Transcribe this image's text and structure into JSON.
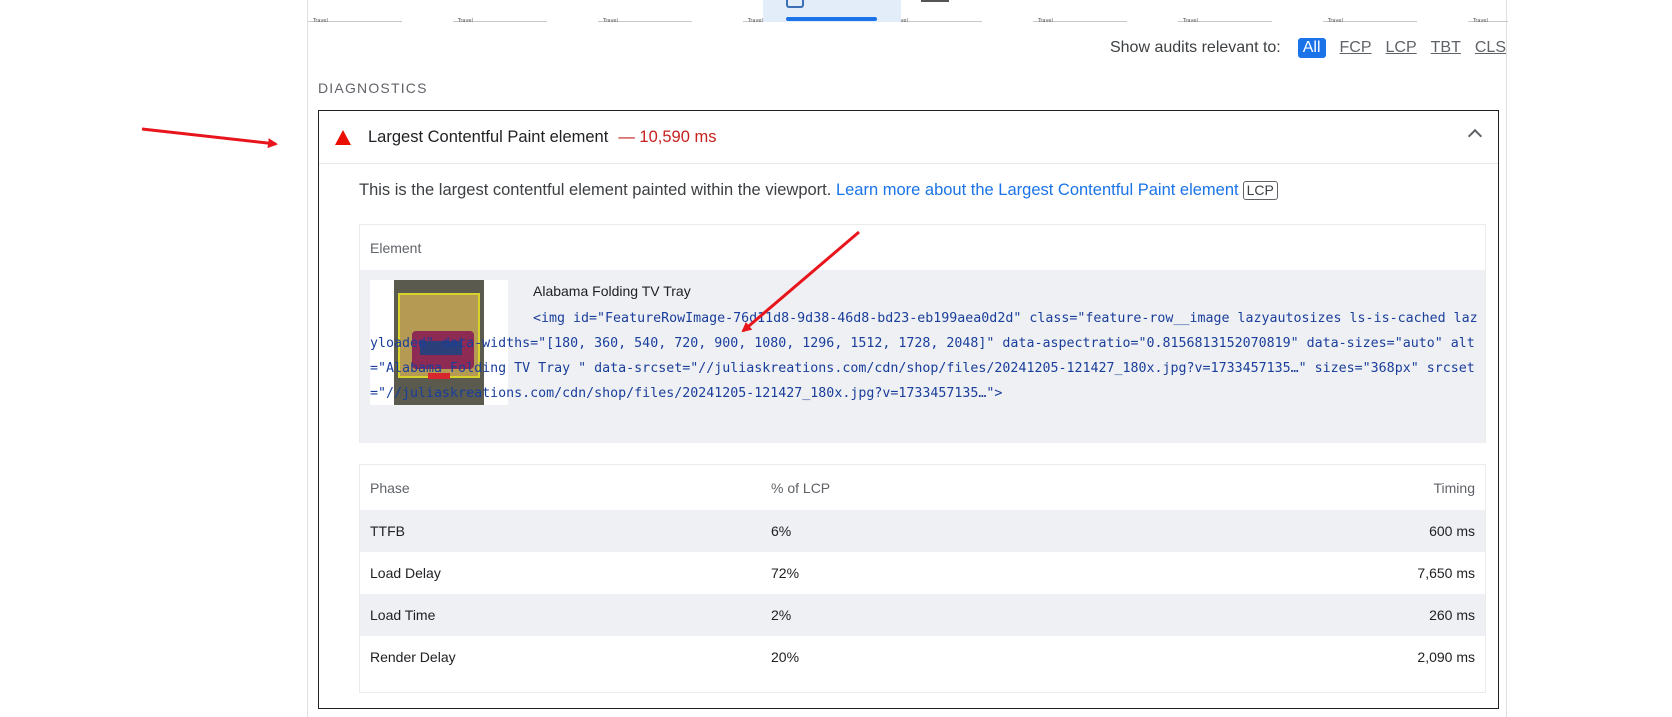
{
  "filmstrip": {
    "frames": [
      "Travel",
      "Travel",
      "Travel",
      "Travel",
      "Travel",
      "Travel",
      "Travel",
      "Travel",
      "Travel"
    ]
  },
  "filter": {
    "label": "Show audits relevant to:",
    "chips": [
      "All",
      "FCP",
      "LCP",
      "TBT",
      "CLS"
    ],
    "active": "All"
  },
  "section": {
    "title": "DIAGNOSTICS"
  },
  "audit": {
    "title": "Largest Contentful Paint element",
    "value": "— 10,590 ms",
    "description": "This is the largest contentful element painted within the viewport.",
    "learn_more": "Learn more about the Largest Contentful Paint element",
    "tag": "LCP"
  },
  "element_table": {
    "header": "Element",
    "node_label": "Alabama Folding TV Tray",
    "snippet": "<img id=\"FeatureRowImage-76d11d8-9d38-46d8-bd23-eb199aea0d2d\" class=\"feature-row__image lazyautosizes ls-is-cached lazyloaded\" data-widths=\"[180, 360, 540, 720, 900, 1080, 1296, 1512, 1728, 2048]\" data-aspectratio=\"0.8156813152070819\" data-sizes=\"auto\" alt=\"Alabama Folding TV Tray \" data-srcset=\"//juliaskreations.com/cdn/shop/files/20241205-121427_180x.jpg?v=1733457135…\" sizes=\"368px\" srcset=\"//juliaskreations.com/cdn/shop/files/20241205-121427_180x.jpg?v=1733457135…\">"
  },
  "phase_table": {
    "headers": [
      "Phase",
      "% of LCP",
      "Timing"
    ],
    "rows": [
      {
        "phase": "TTFB",
        "pct": "6%",
        "timing": "600 ms"
      },
      {
        "phase": "Load Delay",
        "pct": "72%",
        "timing": "7,650 ms"
      },
      {
        "phase": "Load Time",
        "pct": "2%",
        "timing": "260 ms"
      },
      {
        "phase": "Render Delay",
        "pct": "20%",
        "timing": "2,090 ms"
      }
    ]
  },
  "colors": {
    "accent": "#1a73e8",
    "fail": "#eb0f00",
    "annotation_arrow": "#e8161c"
  }
}
